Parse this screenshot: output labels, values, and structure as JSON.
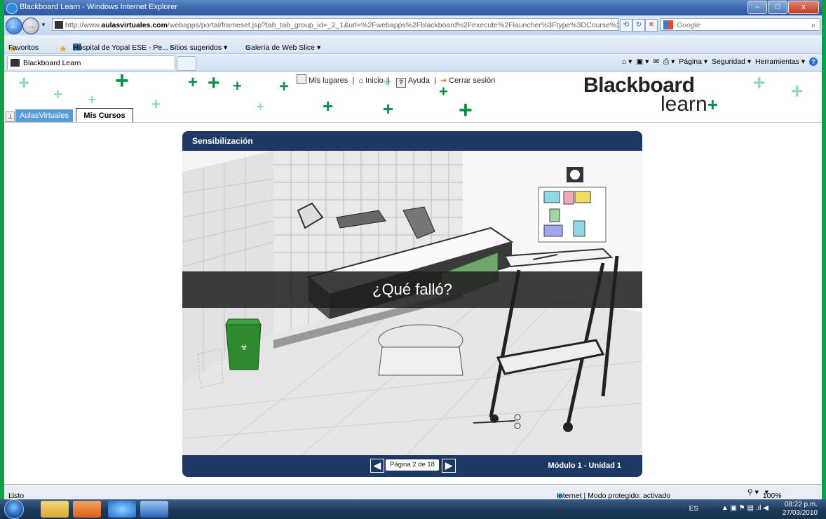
{
  "window": {
    "title": "Blackboard Learn - Windows Internet Explorer",
    "buttons": [
      "–",
      "□",
      "x"
    ]
  },
  "address": {
    "prefix": "http://www.",
    "domain": "aulasvirtuales.com",
    "path": "/webapps/portal/frameset.jsp?tab_tab_group_id=_2_1&url=%2Fwebapps%2Fblackboard%2Fexecute%2Flauncher%3Ftype%3DCourse%26id%3D_1",
    "search_placeholder": "Google"
  },
  "favorites": {
    "label": "Favoritos",
    "items": [
      "Hospital de Yopal ESE - Pe...",
      "Sitios sugeridos ▾",
      "Galería de Web Slice ▾"
    ]
  },
  "tabs": [
    {
      "label": "Blackboard Learn"
    }
  ],
  "commandbar": {
    "pagina": "Página ▾",
    "seguridad": "Seguridad ▾",
    "herramientas": "Herramientas ▾",
    "help": "?"
  },
  "bb": {
    "nav": {
      "mis_lugares": "Mis lugares",
      "inicio": "Inicio",
      "ayuda": "Ayuda",
      "cerrar": "Cerrar sesión"
    },
    "logo": {
      "line1": "Blackboard",
      "line2": "learn",
      "plus": "+"
    },
    "course_tabs": [
      "AulasVirtuales",
      "Mis Cursos"
    ]
  },
  "player": {
    "title": "Sensibilización",
    "overlay": "¿Qué falló?",
    "pager": "Página 2 de 18",
    "module": "Módulo 1 - Unidad 1"
  },
  "status": {
    "left": "Listo",
    "zone": "Internet | Modo protegido: activado",
    "zoom": "100%"
  },
  "taskbar": {
    "lang": "ES",
    "time": "08:22 p.m.",
    "date": "27/03/2010"
  }
}
